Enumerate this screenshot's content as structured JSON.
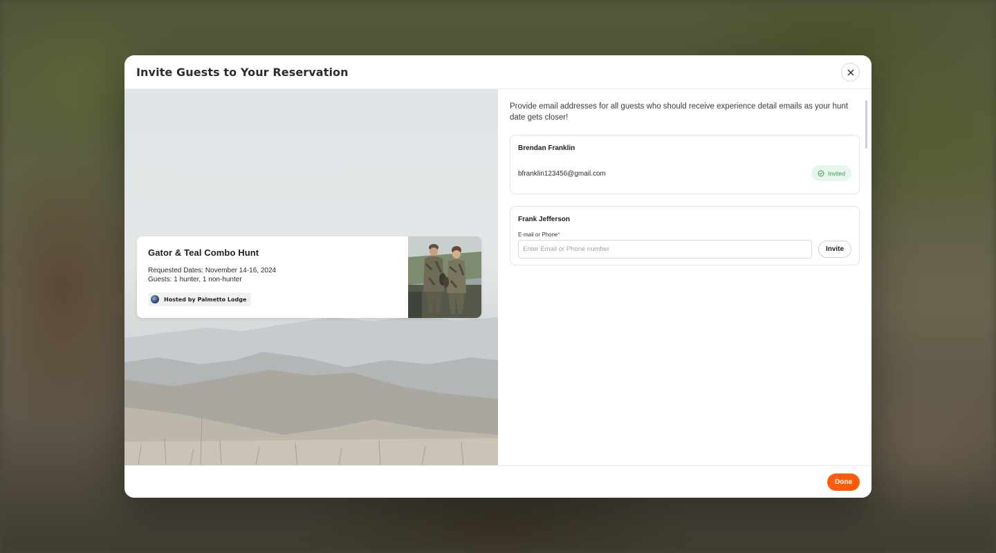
{
  "modal": {
    "title": "Invite Guests to Your Reservation",
    "close_icon": "close-icon"
  },
  "hunt": {
    "title": "Gator & Teal Combo Hunt",
    "dates": "Requested Dates: November 14-16, 2024",
    "guests": "Guests: 1 hunter, 1 non-hunter",
    "host": "Hosted by Palmetto Lodge"
  },
  "intro_text": "Provide email addresses for all guests who should receive experience detail emails as your hunt date gets closer!",
  "guests": [
    {
      "name": "Brendan Franklin",
      "email": "bfranklin123456@gmail.com",
      "status": "Invited",
      "status_icon": "check-circle-icon"
    },
    {
      "name": "Frank Jefferson",
      "field_label": "E-mail or Phone",
      "required_mark": "*",
      "placeholder": "Enter Email or Phone number",
      "value": "",
      "invite_label": "Invite"
    }
  ],
  "footer": {
    "done_label": "Done"
  },
  "colors": {
    "accent": "#ff5b0a",
    "success_text": "#2e9e55",
    "success_bg": "#e7f6ec",
    "required": "#e53935"
  }
}
